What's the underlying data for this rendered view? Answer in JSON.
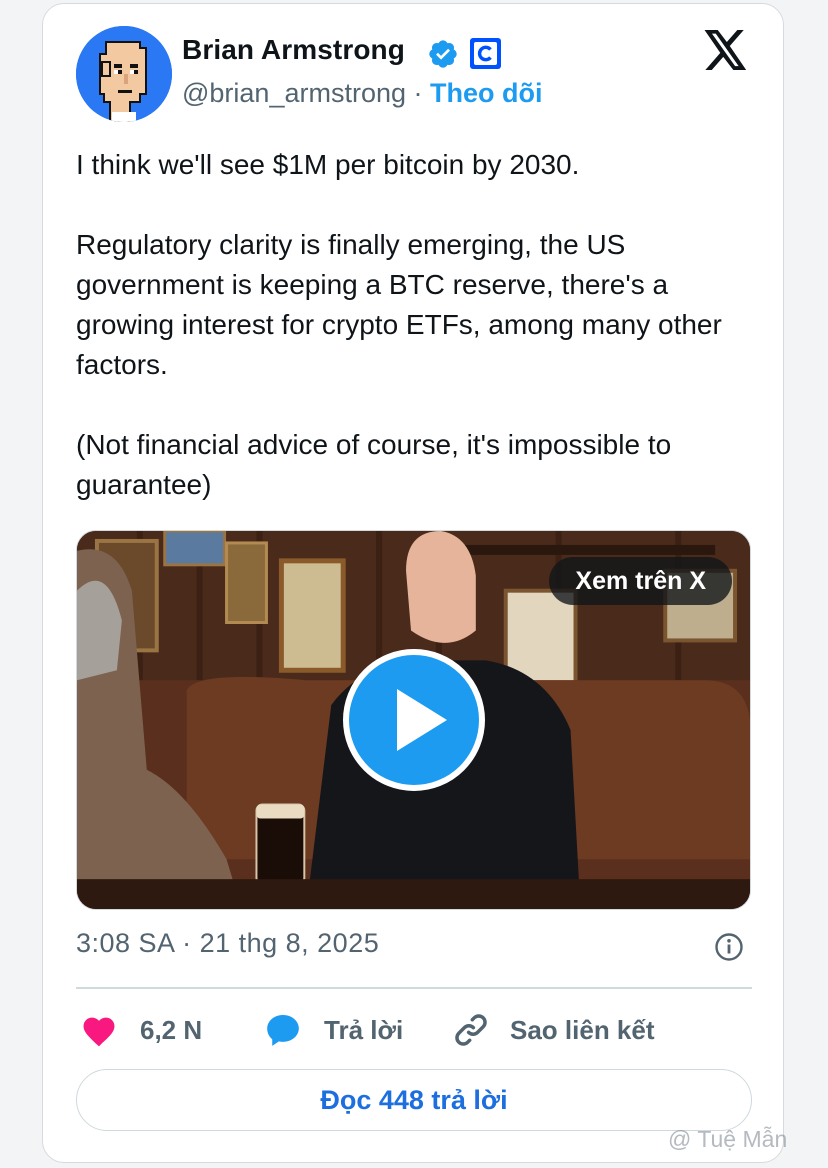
{
  "author": {
    "name": "Brian Armstrong",
    "handle": "@brian_armstrong",
    "separator": "·",
    "follow_label": "Theo dõi",
    "verified_icon": "verified-badge-icon",
    "affiliate_icon": "coinbase-logo-icon"
  },
  "platform_icon": "x-logo-icon",
  "tweet": {
    "paragraphs": [
      "I think we'll see $1M per bitcoin by 2030.",
      "Regulatory clarity is finally emerging, the US government is keeping a BTC reserve, there's a growing interest for crypto ETFs, among many other factors.",
      "(Not financial advice of course, it's impossible to guarantee)"
    ]
  },
  "media": {
    "watch_label": "Xem trên X",
    "play_icon": "play-icon"
  },
  "timestamp": "3:08 SA · 21 thg 8, 2025",
  "actions": {
    "likes_count": "6,2 N",
    "reply_label": "Trả lời",
    "copy_link_label": "Sao liên kết"
  },
  "read_replies_label": "Đọc 448 trả lời",
  "watermark": "@ Tuệ Mẫn",
  "colors": {
    "accent": "#1d9bf0",
    "heart": "#f91880",
    "text": "#0f1419",
    "muted": "#536471"
  }
}
